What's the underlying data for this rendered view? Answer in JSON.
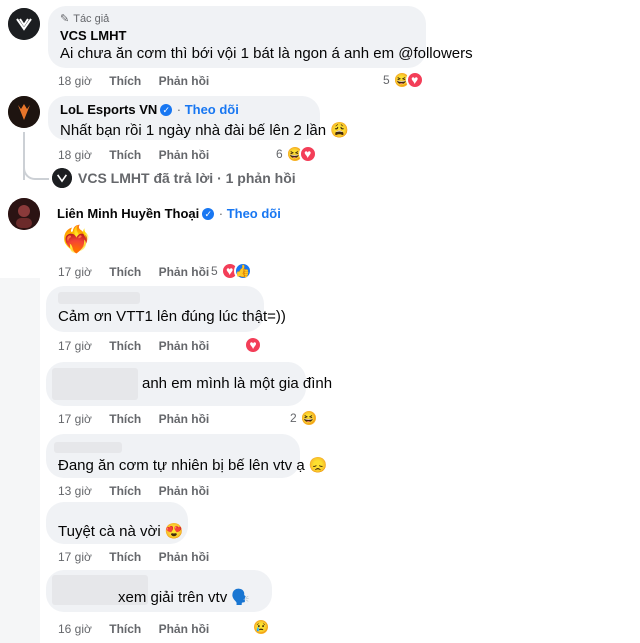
{
  "comments": [
    {
      "author_badge": "Tác giả",
      "author": "VCS LMHT",
      "text": "Ai chưa ăn cơm thì bới vội 1 bát là ngon á anh em @followers",
      "time": "18 giờ",
      "like": "Thích",
      "reply": "Phản hồi",
      "reaction_count": "5"
    },
    {
      "author": "LoL Esports VN",
      "follow": "Theo dõi",
      "text": "Nhất bạn rồi 1 ngày nhà đài bế lên 2 lần 😩",
      "time": "18 giờ",
      "like": "Thích",
      "reply": "Phản hồi",
      "reaction_count": "6",
      "replies_summary": "VCS LMHT đã trả lời · 1 phản hồi"
    },
    {
      "author": "Liên Minh Huyền Thoại",
      "follow": "Theo dõi",
      "text": "❤️‍🔥",
      "time": "17 giờ",
      "like": "Thích",
      "reply": "Phản hồi",
      "reaction_count": "5"
    },
    {
      "text": "Cảm ơn VTT1 lên đúng lúc thật=))",
      "time": "17 giờ",
      "like": "Thích",
      "reply": "Phản hồi"
    },
    {
      "text": "anh em mình là một gia đình",
      "time": "17 giờ",
      "like": "Thích",
      "reply": "Phản hồi",
      "reaction_count": "2"
    },
    {
      "text": "Đang ăn cơm tự nhiên bị bế lên vtv ạ 😞",
      "time": "13 giờ",
      "like": "Thích",
      "reply": "Phản hồi"
    },
    {
      "text": "Tuyệt cà nà vời 😍",
      "time": "17 giờ",
      "like": "Thích",
      "reply": "Phản hồi"
    },
    {
      "text": "xem giải trên vtv 🗣️",
      "time": "16 giờ",
      "like": "Thích",
      "reply": "Phản hồi"
    }
  ],
  "colors": {
    "bubble": "#f0f2f5",
    "link_blue": "#1877f2",
    "meta_gray": "#65676b",
    "love_red": "#f33e58",
    "haha_yellow": "#f7b125"
  },
  "icons": [
    "pen-icon",
    "verified-icon",
    "haha-icon",
    "love-icon",
    "like-icon",
    "sad-icon",
    "heart-fire-icon",
    "speaking-head-icon"
  ]
}
